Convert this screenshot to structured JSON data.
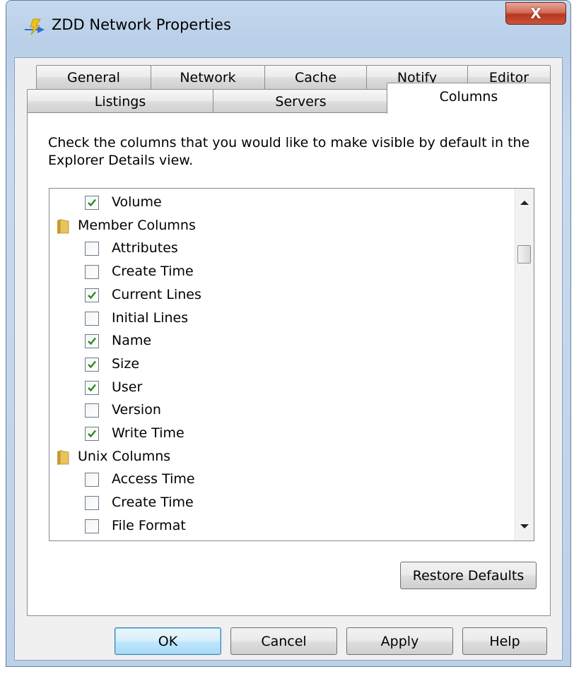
{
  "window": {
    "title": "ZDD Network Properties",
    "close_glyph": "X"
  },
  "tabs": {
    "row1": [
      "General",
      "Network",
      "Cache",
      "Notify",
      "Editor"
    ],
    "row2": [
      "Listings",
      "Servers",
      "Columns"
    ],
    "active": "Columns"
  },
  "panel": {
    "instructions": "Check the columns that you would like to make visible by default in the Explorer Details view.",
    "restore_label": "Restore Defaults"
  },
  "tree": {
    "items": [
      {
        "type": "check",
        "label": "Volume",
        "checked": true
      },
      {
        "type": "folder",
        "label": "Member Columns"
      },
      {
        "type": "check",
        "label": "Attributes",
        "checked": false
      },
      {
        "type": "check",
        "label": "Create Time",
        "checked": false
      },
      {
        "type": "check",
        "label": "Current Lines",
        "checked": true
      },
      {
        "type": "check",
        "label": "Initial Lines",
        "checked": false
      },
      {
        "type": "check",
        "label": "Name",
        "checked": true
      },
      {
        "type": "check",
        "label": "Size",
        "checked": true
      },
      {
        "type": "check",
        "label": "User",
        "checked": true
      },
      {
        "type": "check",
        "label": "Version",
        "checked": false
      },
      {
        "type": "check",
        "label": "Write Time",
        "checked": true
      },
      {
        "type": "folder",
        "label": "Unix Columns"
      },
      {
        "type": "check",
        "label": "Access Time",
        "checked": false
      },
      {
        "type": "check",
        "label": "Create Time",
        "checked": false
      },
      {
        "type": "check",
        "label": "File Format",
        "checked": false
      }
    ]
  },
  "buttons": {
    "ok": "OK",
    "cancel": "Cancel",
    "apply": "Apply",
    "help": "Help"
  },
  "colors": {
    "check": "#2a8a1f",
    "folder": "#e8c45a"
  }
}
